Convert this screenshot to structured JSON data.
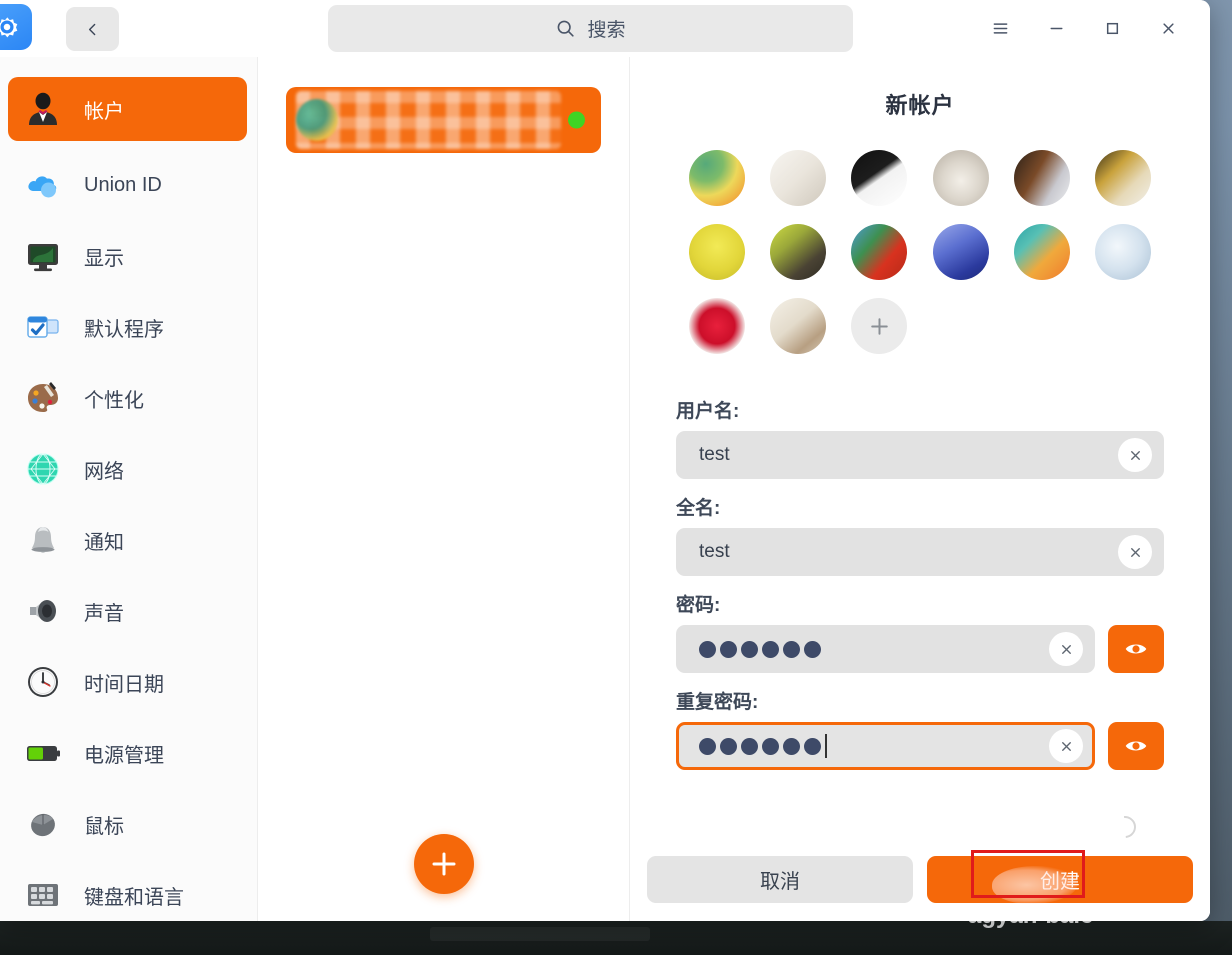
{
  "window": {
    "app_icon": "gear-icon",
    "back_icon": "chevron-left-icon",
    "controls": {
      "menu_icon": "hamburger-menu-icon",
      "minimize_icon": "minimize-icon",
      "maximize_icon": "maximize-icon",
      "close_icon": "close-icon"
    }
  },
  "search": {
    "icon": "search-icon",
    "placeholder": "搜索"
  },
  "sidebar": {
    "items": [
      {
        "label": "帐户",
        "icon": "account-person-icon",
        "active": true
      },
      {
        "label": "Union ID",
        "icon": "cloud-icon",
        "active": false
      },
      {
        "label": "显示",
        "icon": "monitor-display-icon",
        "active": false
      },
      {
        "label": "默认程序",
        "icon": "default-apps-icon",
        "active": false
      },
      {
        "label": "个性化",
        "icon": "palette-icon",
        "active": false
      },
      {
        "label": "网络",
        "icon": "globe-network-icon",
        "active": false
      },
      {
        "label": "通知",
        "icon": "bell-icon",
        "active": false
      },
      {
        "label": "声音",
        "icon": "speaker-icon",
        "active": false
      },
      {
        "label": "时间日期",
        "icon": "clock-icon",
        "active": false
      },
      {
        "label": "电源管理",
        "icon": "battery-icon",
        "active": false
      },
      {
        "label": "鼠标",
        "icon": "mouse-icon",
        "active": false
      },
      {
        "label": "键盘和语言",
        "icon": "keyboard-icon",
        "active": false
      }
    ]
  },
  "account_list": {
    "cards": [
      {
        "name_redacted": true,
        "status_color": "#3fd424",
        "status": "online"
      }
    ],
    "add_button": {
      "icon": "plus-icon",
      "label": ""
    }
  },
  "form": {
    "title": "新帐户",
    "avatars": [
      {
        "name": "avatar-tulip-flower",
        "color_a": "#e9d98a",
        "color_b": "#49a06b"
      },
      {
        "name": "avatar-white-sketch",
        "color_a": "#f4f1ec",
        "color_b": "#d9d3c9"
      },
      {
        "name": "avatar-piano-keys",
        "color_a": "#1a1a1a",
        "color_b": "#f0f0f0"
      },
      {
        "name": "avatar-kitten",
        "color_a": "#e6e3de",
        "color_b": "#b9b2a8"
      },
      {
        "name": "avatar-horse",
        "color_a": "#7b4a2a",
        "color_b": "#e8e8ea"
      },
      {
        "name": "avatar-leopard",
        "color_a": "#caa23c",
        "color_b": "#ece7dc"
      },
      {
        "name": "avatar-ladybug",
        "color_a": "#e9e04a",
        "color_b": "#c8bf2e"
      },
      {
        "name": "avatar-butterfly",
        "color_a": "#c5d63b",
        "color_b": "#4c4230"
      },
      {
        "name": "avatar-parrot",
        "color_a": "#3b8f4c",
        "color_b": "#d83226"
      },
      {
        "name": "avatar-hot-air-balloon",
        "color_a": "#7a8fe0",
        "color_b": "#2b3f9e"
      },
      {
        "name": "avatar-balloons",
        "color_a": "#2aa3a8",
        "color_b": "#f0802c"
      },
      {
        "name": "avatar-dragonfly",
        "color_a": "#dfe9f2",
        "color_b": "#9fb8cc"
      },
      {
        "name": "avatar-raspberry",
        "color_a": "#f4f2f0",
        "color_b": "#d8102a"
      },
      {
        "name": "avatar-beige-interior",
        "color_a": "#efe9dd",
        "color_b": "#b5a189"
      }
    ],
    "add_avatar": {
      "icon": "plus-icon"
    },
    "fields": [
      {
        "label": "用户名:",
        "value": "test",
        "type": "text",
        "focused": false,
        "clear_icon": "close-circle-icon",
        "has_reveal": false
      },
      {
        "label": "全名:",
        "value": "test",
        "type": "text",
        "focused": false,
        "clear_icon": "close-circle-icon",
        "has_reveal": false
      },
      {
        "label": "密码:",
        "value": "••••••",
        "dot_count": 6,
        "type": "password",
        "focused": false,
        "clear_icon": "close-circle-icon",
        "has_reveal": true,
        "reveal_icon": "eye-icon"
      },
      {
        "label": "重复密码:",
        "value": "••••••",
        "dot_count": 6,
        "type": "password",
        "focused": true,
        "clear_icon": "close-circle-icon",
        "has_reveal": true,
        "reveal_icon": "eye-icon"
      }
    ]
  },
  "footer": {
    "cancel_label": "取消",
    "create_label": "创建"
  },
  "annotation": {
    "watermark_text": "agyan-baic",
    "box_color": "#e01b1b"
  },
  "theme": {
    "accent": "#F5680A",
    "text": "#3b4557",
    "input_bg": "#e2e2e2",
    "dot_color": "#3e4a68",
    "status_green": "#3fd424"
  }
}
